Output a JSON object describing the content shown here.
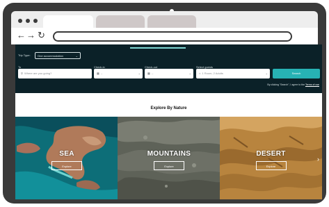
{
  "search_form": {
    "trip_type_label": "Trip Type:",
    "trip_type_value": "One accommodation",
    "to_label": "To",
    "to_placeholder": "Where are you going?",
    "checkin_label": "Check-in",
    "checkin_value": "--",
    "checkout_label": "Check-out",
    "checkout_value": "--",
    "guests_label": "Select guests",
    "guests_value": "1 Room, 2 Adults",
    "search_label": "Search",
    "terms_text": "By clicking \"Search\", I agree to the",
    "terms_link": "Terms of use"
  },
  "explore": {
    "title": "Explore By Nature",
    "cards": [
      {
        "title": "SEA",
        "button": "Explore"
      },
      {
        "title": "MOUNTAINS",
        "button": "Explore"
      },
      {
        "title": "DESERT",
        "button": "Explore"
      }
    ]
  },
  "colors": {
    "hero_bg": "#0b2128",
    "accent": "#27b2b4",
    "device_frame": "#3a3a3a"
  }
}
